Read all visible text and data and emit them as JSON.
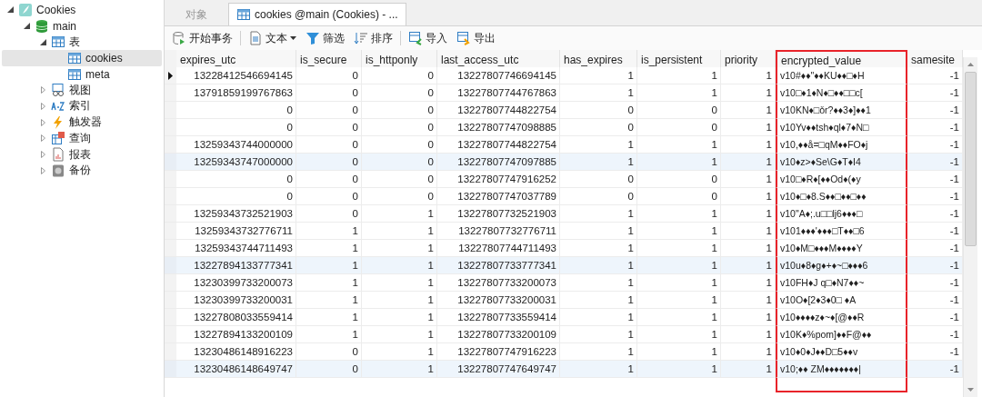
{
  "sidebar": {
    "tree": [
      {
        "label": "Cookies",
        "kind": "database",
        "expanded": true,
        "selected": false,
        "children": [
          {
            "label": "main",
            "kind": "schema",
            "expanded": true,
            "selected": false,
            "children": [
              {
                "label": "表",
                "kind": "tables",
                "expanded": true,
                "selected": false,
                "children": [
                  {
                    "label": "cookies",
                    "kind": "table",
                    "selected": true
                  },
                  {
                    "label": "meta",
                    "kind": "table",
                    "selected": false
                  }
                ]
              },
              {
                "label": "视图",
                "kind": "views",
                "expanded": false,
                "selected": false
              },
              {
                "label": "索引",
                "kind": "index",
                "expanded": false,
                "selected": false
              },
              {
                "label": "触发器",
                "kind": "trigger",
                "expanded": false,
                "selected": false
              },
              {
                "label": "查询",
                "kind": "query",
                "expanded": false,
                "selected": false
              },
              {
                "label": "报表",
                "kind": "report",
                "expanded": false,
                "selected": false
              },
              {
                "label": "备份",
                "kind": "backup",
                "expanded": false,
                "selected": false
              }
            ]
          }
        ]
      }
    ]
  },
  "tabs": [
    {
      "label": "对象",
      "icon": false,
      "selected": false
    },
    {
      "label": "cookies @main (Cookies) - ...",
      "icon": true,
      "selected": true
    }
  ],
  "toolbar": [
    {
      "label": "开始事务",
      "kind": "transaction",
      "caret": false
    },
    {
      "label": "文本",
      "kind": "text",
      "caret": true
    },
    {
      "label": "筛选",
      "kind": "filter",
      "caret": false
    },
    {
      "label": "排序",
      "kind": "sort",
      "caret": false
    },
    {
      "label": "导入",
      "kind": "import",
      "caret": false
    },
    {
      "label": "导出",
      "kind": "export",
      "caret": false
    }
  ],
  "table": {
    "columns": [
      {
        "label": "expires_utc",
        "highlighted": false
      },
      {
        "label": "is_secure",
        "highlighted": false
      },
      {
        "label": "is_httponly",
        "highlighted": false
      },
      {
        "label": "last_access_utc",
        "highlighted": false
      },
      {
        "label": "has_expires",
        "highlighted": false
      },
      {
        "label": "is_persistent",
        "highlighted": false
      },
      {
        "label": "priority",
        "highlighted": false
      },
      {
        "label": "encrypted_value",
        "highlighted": true
      },
      {
        "label": "samesite",
        "highlighted": false
      }
    ],
    "rows": [
      {
        "current": true,
        "tinted": false,
        "cells": [
          "13228412546694145",
          "0",
          "0",
          "13227807746694145",
          "1",
          "1",
          "1",
          "v10#♦♦\"♦♦KU♦♦□♦H",
          "-1"
        ]
      },
      {
        "current": false,
        "tinted": false,
        "cells": [
          "13791859199767863",
          "0",
          "0",
          "13227807744767863",
          "1",
          "1",
          "1",
          "v10□♦1♦N♦□♦♦□□c[",
          "-1"
        ]
      },
      {
        "current": false,
        "tinted": false,
        "cells": [
          "0",
          "0",
          "0",
          "13227807744822754",
          "0",
          "0",
          "1",
          "v10KN♦□ǒr?♦♦3♦]♦♦1",
          "-1"
        ]
      },
      {
        "current": false,
        "tinted": false,
        "cells": [
          "0",
          "0",
          "0",
          "13227807747098885",
          "0",
          "0",
          "1",
          "v10Yv♦♦tsh♦ql♦7♦N□",
          "-1"
        ]
      },
      {
        "current": false,
        "tinted": false,
        "cells": [
          "13259343744000000",
          "0",
          "0",
          "13227807744822754",
          "1",
          "1",
          "1",
          "v10,♦♦å=□qM♦♦FO♦j",
          "-1"
        ]
      },
      {
        "current": false,
        "tinted": true,
        "cells": [
          "13259343747000000",
          "0",
          "0",
          "13227807747097885",
          "1",
          "1",
          "1",
          "v10♦z>♦Se\\G♦T♦I4",
          "-1"
        ]
      },
      {
        "current": false,
        "tinted": false,
        "cells": [
          "0",
          "0",
          "0",
          "13227807747916252",
          "0",
          "0",
          "1",
          "v10□♦R♦[♦♦Od♦(♦y",
          "-1"
        ]
      },
      {
        "current": false,
        "tinted": false,
        "cells": [
          "0",
          "0",
          "0",
          "13227807747037789",
          "0",
          "0",
          "1",
          "v10♦□♦8.S♦♦□♦♦□♦♦",
          "-1"
        ]
      },
      {
        "current": false,
        "tinted": false,
        "cells": [
          "13259343732521903",
          "0",
          "1",
          "13227807732521903",
          "1",
          "1",
          "1",
          "v10\"A♦;.u□□lj6♦♦♦□",
          "-1"
        ]
      },
      {
        "current": false,
        "tinted": false,
        "cells": [
          "13259343732776711",
          "1",
          "1",
          "13227807732776711",
          "1",
          "1",
          "1",
          "v101♦♦♦'♦♦♦□T♦♦□6",
          "-1"
        ]
      },
      {
        "current": false,
        "tinted": false,
        "cells": [
          "13259343744711493",
          "1",
          "1",
          "13227807744711493",
          "1",
          "1",
          "1",
          "v10♦M□♦♦♦M♦♦♦♦Y",
          "-1"
        ]
      },
      {
        "current": false,
        "tinted": true,
        "cells": [
          "13227894133777341",
          "1",
          "1",
          "13227807733777341",
          "1",
          "1",
          "1",
          "v10u♦8♦g♦+♦~□♦♦♦6",
          "-1"
        ]
      },
      {
        "current": false,
        "tinted": false,
        "cells": [
          "13230399733200073",
          "1",
          "1",
          "13227807733200073",
          "1",
          "1",
          "1",
          "v10FH♦J  q□♦N7♦♦~",
          "-1"
        ]
      },
      {
        "current": false,
        "tinted": false,
        "cells": [
          "13230399733200031",
          "1",
          "1",
          "13227807733200031",
          "1",
          "1",
          "1",
          "v10O♦[2♦3♦0□   ♦A",
          "-1"
        ]
      },
      {
        "current": false,
        "tinted": false,
        "cells": [
          "13227808033559414",
          "1",
          "1",
          "13227807733559414",
          "1",
          "1",
          "1",
          "v10♦♦♦♦z♦~♦[@♦♦R",
          "-1"
        ]
      },
      {
        "current": false,
        "tinted": false,
        "cells": [
          "13227894133200109",
          "1",
          "1",
          "13227807733200109",
          "1",
          "1",
          "1",
          "v10K♦%pom]♦♦F@♦♦",
          "-1"
        ]
      },
      {
        "current": false,
        "tinted": false,
        "cells": [
          "13230486148916223",
          "0",
          "1",
          "13227807747916223",
          "1",
          "1",
          "1",
          "v10♦0♦J♦♦D□5♦♦v",
          "-1"
        ]
      },
      {
        "current": false,
        "tinted": true,
        "cells": [
          "13230486148649747",
          "0",
          "1",
          "13227807747649747",
          "1",
          "1",
          "1",
          "v10;♦♦  ZM♦♦♦♦♦♦♦|",
          "-1"
        ]
      }
    ]
  }
}
